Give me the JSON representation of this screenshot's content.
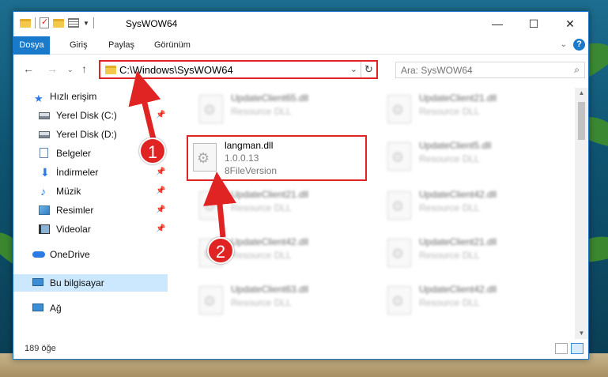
{
  "window": {
    "title": "SysWOW64"
  },
  "ribbon": {
    "tabs": [
      "Dosya",
      "Giriş",
      "Paylaş",
      "Görünüm"
    ]
  },
  "address": {
    "path": "C:\\Windows\\SysWOW64"
  },
  "search": {
    "placeholder": "Ara: SysWOW64"
  },
  "sidebar": {
    "items": [
      {
        "label": "Hızlı erişim",
        "icon": "star-icon"
      },
      {
        "label": "Yerel Disk (C:)",
        "icon": "drive-icon"
      },
      {
        "label": "Yerel Disk (D:)",
        "icon": "drive-icon"
      },
      {
        "label": "Belgeler",
        "icon": "documents-icon"
      },
      {
        "label": "İndirmeler",
        "icon": "downloads-icon"
      },
      {
        "label": "Müzik",
        "icon": "music-icon"
      },
      {
        "label": "Resimler",
        "icon": "pictures-icon"
      },
      {
        "label": "Videolar",
        "icon": "videos-icon"
      },
      {
        "label": "OneDrive",
        "icon": "onedrive-icon"
      },
      {
        "label": "Bu bilgisayar",
        "icon": "this-pc-icon"
      },
      {
        "label": "Ağ",
        "icon": "network-icon"
      }
    ]
  },
  "files": {
    "col1": [
      {
        "name": "UpdateClient65.dll",
        "type": "Resource DLL"
      },
      {
        "name": "langman.dll",
        "version": "1.0.0.13",
        "desc": "8FileVersion"
      },
      {
        "name": "UpdateClient21.dll",
        "type": "Resource DLL"
      },
      {
        "name": "UpdateClient42.dll",
        "type": "Resource DLL"
      },
      {
        "name": "UpdateClient63.dll",
        "type": "Resource DLL"
      }
    ],
    "col2": [
      {
        "name": "UpdateClient21.dll",
        "type": "Resource DLL"
      },
      {
        "name": "UpdateClient5.dll",
        "type": "Resource DLL"
      },
      {
        "name": "UpdateClient42.dll",
        "type": "Resource DLL"
      },
      {
        "name": "UpdateClient21.dll",
        "type": "Resource DLL"
      },
      {
        "name": "UpdateClient42.dll",
        "type": "Resource DLL"
      }
    ]
  },
  "status": {
    "count": "189 öğe"
  },
  "callouts": [
    "1",
    "2"
  ],
  "colors": {
    "accent": "#1979ca",
    "highlight": "#e02424",
    "selected": "#cce8ff"
  }
}
